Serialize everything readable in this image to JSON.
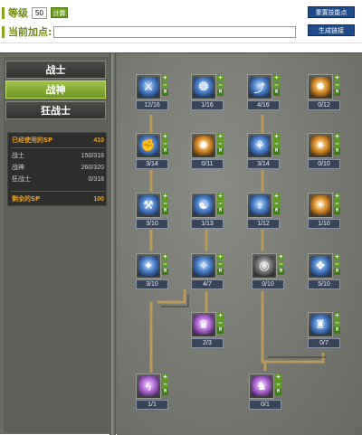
{
  "header": {
    "level_label": "等级",
    "level_value": "50",
    "calc_button": "计算",
    "reset_button": "重置技能点",
    "current_points_label": "当前加点:",
    "current_points_value": "",
    "generate_button": "生成链接"
  },
  "tabs": [
    {
      "label": "战士",
      "active": false
    },
    {
      "label": "战神",
      "active": true
    },
    {
      "label": "狂战士",
      "active": false
    }
  ],
  "stats": {
    "used_label": "已经使用的SP",
    "used_value": "410",
    "rows": [
      {
        "label": "战士",
        "value": "150/318"
      },
      {
        "label": "战神",
        "value": "260/320"
      },
      {
        "label": "狂战士",
        "value": "0/318"
      }
    ],
    "remain_label": "剩余的SP",
    "remain_value": "100"
  },
  "colors": {
    "accent_green": "#6e9422",
    "accent_orange": "#e8a020",
    "button_blue": "#1f4a8a",
    "connector_gold": "#b89a5a"
  },
  "skills": [
    {
      "icon": "sword-icon",
      "style": "blue",
      "glyph": "⚔",
      "level": "12/16"
    },
    {
      "icon": "wolf-icon",
      "style": "blue",
      "glyph": "❂",
      "level": "1/16"
    },
    {
      "icon": "slash-icon",
      "style": "blue",
      "glyph": "⤴",
      "level": "4/16"
    },
    {
      "icon": "shield-bash-icon",
      "style": "orange",
      "glyph": "✸",
      "level": "0/12"
    },
    {
      "icon": "fist-icon",
      "style": "blue",
      "glyph": "✊",
      "level": "3/14"
    },
    {
      "icon": "burst-icon",
      "style": "orange",
      "glyph": "✺",
      "level": "0/11"
    },
    {
      "icon": "claw-icon",
      "style": "blue",
      "glyph": "⚘",
      "level": "3/14"
    },
    {
      "icon": "star-icon",
      "style": "orange",
      "glyph": "✷",
      "level": "0/10"
    },
    {
      "icon": "hammer-icon",
      "style": "blue",
      "glyph": "⚒",
      "level": "3/10"
    },
    {
      "icon": "beast-icon",
      "style": "blue",
      "glyph": "☯",
      "level": "1/13"
    },
    {
      "icon": "flame-icon",
      "style": "blue",
      "glyph": "♆",
      "level": "1/12"
    },
    {
      "icon": "aura-icon",
      "style": "orange",
      "glyph": "☀",
      "level": "1/10"
    },
    {
      "icon": "whirl-icon",
      "style": "blue",
      "glyph": "✦",
      "level": "3/10"
    },
    {
      "icon": "spirit-icon",
      "style": "blue",
      "glyph": "✧",
      "level": "4/7"
    },
    {
      "icon": "spin-icon",
      "style": "gray",
      "glyph": "◎",
      "level": "0/10"
    },
    {
      "icon": "rune-icon",
      "style": "blue",
      "glyph": "❖",
      "level": "5/10"
    },
    {
      "icon": "demon-icon",
      "style": "purple",
      "glyph": "♛",
      "level": "2/3"
    },
    {
      "icon": "guardian-icon",
      "style": "blue",
      "glyph": "♜",
      "level": "0/7"
    },
    {
      "icon": "thunder-icon",
      "style": "purple",
      "glyph": "ϟ",
      "level": "1/1"
    },
    {
      "icon": "phantom-icon",
      "style": "purple",
      "glyph": "♞",
      "level": "0/1"
    }
  ],
  "skill_button_labels": {
    "plus": "+",
    "minus": "−",
    "max": "M"
  }
}
